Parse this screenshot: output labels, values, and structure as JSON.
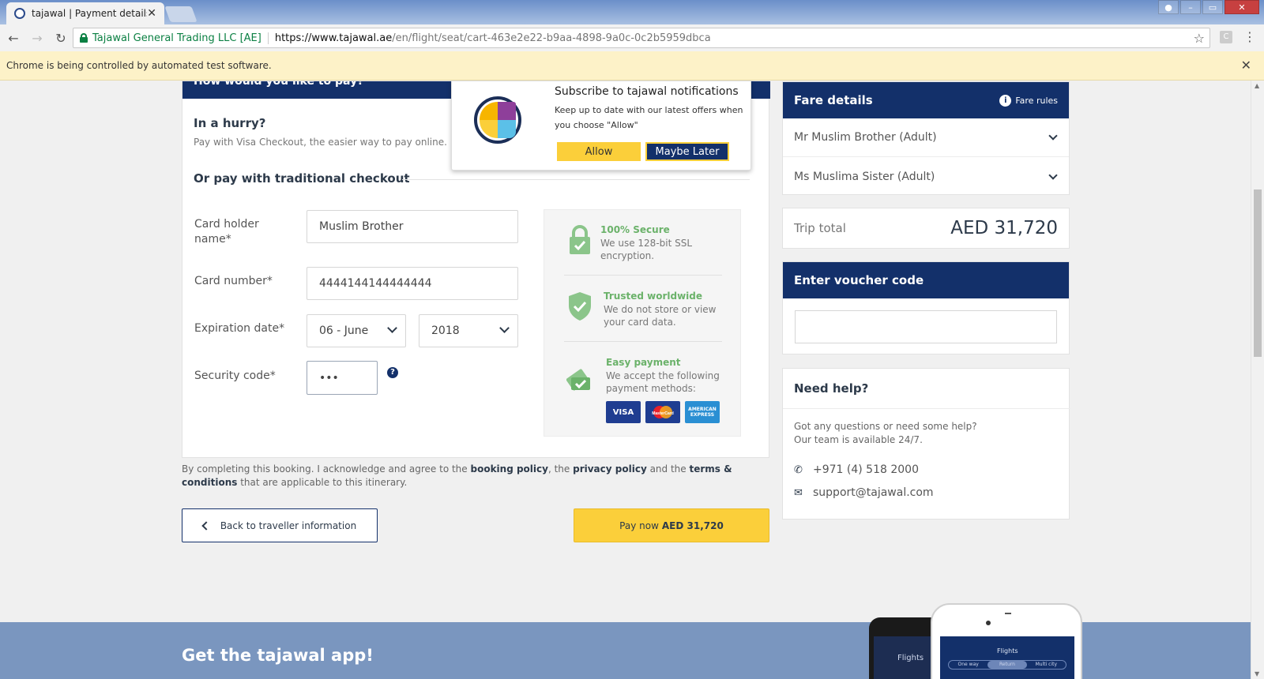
{
  "browser": {
    "tab_title": "tajawal | Payment details",
    "tab_close": "✕",
    "secure_label": "Tajawal General Trading LLC [AE]",
    "url_host": "https://www.tajawal.ae",
    "url_path": "/en/flight/seat/cart-463e2e22-b9aa-4898-9a0c-0c2b5959dbca",
    "infobar_text": "Chrome is being controlled by automated test software.",
    "infobar_close": "✕"
  },
  "payment": {
    "header_partial": "How would you like to pay?",
    "hurry_title": "In a hurry?",
    "hurry_sub": "Pay with Visa Checkout, the easier way to pay online.",
    "traditional_title": "Or pay with traditional checkout",
    "card_holder_label": "Card holder name*",
    "card_holder_value": "Muslim Brother",
    "card_number_label": "Card number*",
    "card_number_value": "4444144144444444",
    "expiry_label": "Expiration date*",
    "expiry_month": "06 - June",
    "expiry_year": "2018",
    "security_label": "Security code*",
    "security_value": "•••",
    "help_glyph": "?"
  },
  "secure_panel": {
    "secure_title": "100% Secure",
    "secure_text": "We use 128-bit SSL encryption.",
    "trusted_title": "Trusted worldwide",
    "trusted_text": "We do not store or view your card data.",
    "easy_title": "Easy payment",
    "easy_text": "We accept the following payment methods:",
    "cards": [
      "VISA",
      "MasterCard",
      "AMERICAN EXPRESS"
    ]
  },
  "legal": {
    "prefix": "By completing this booking. I acknowledge and agree to the ",
    "booking_policy": "booking policy",
    "sep1": ", the ",
    "privacy_policy": "privacy policy",
    "sep2": " and the ",
    "terms": "terms & conditions",
    "suffix": " that are applicable to this itinerary."
  },
  "buttons": {
    "back_label": "Back to traveller information",
    "pay_prefix": "Pay now",
    "pay_amount": "AED 31,720"
  },
  "fare": {
    "title": "Fare details",
    "rules_label": "Fare rules",
    "info_glyph": "i",
    "passengers": [
      "Mr Muslim Brother (Adult)",
      "Ms Muslima Sister (Adult)"
    ],
    "trip_total_label": "Trip total",
    "trip_total_value": "AED 31,720"
  },
  "voucher": {
    "title": "Enter voucher code",
    "value": ""
  },
  "help": {
    "title": "Need help?",
    "line1": "Got any questions or need some help?",
    "line2": "Our team is available 24/7.",
    "phone": "+971 (4) 518 2000",
    "email": "support@tajawal.com"
  },
  "notification": {
    "title": "Subscribe to tajawal notifications",
    "text": "Keep up to date with our latest offers when you choose \"Allow\"",
    "allow": "Allow",
    "later": "Maybe Later"
  },
  "app_banner": {
    "title": "Get the tajawal app!",
    "phone_back_label": "Flights",
    "phone_front_title": "Flights",
    "segments": [
      "One way",
      "Return",
      "Multi city"
    ]
  },
  "colors": {
    "navy": "#13306a",
    "yellow": "#fbcf3a",
    "secure_green": "#6bb26a",
    "banner_blue": "#7a96bf"
  }
}
